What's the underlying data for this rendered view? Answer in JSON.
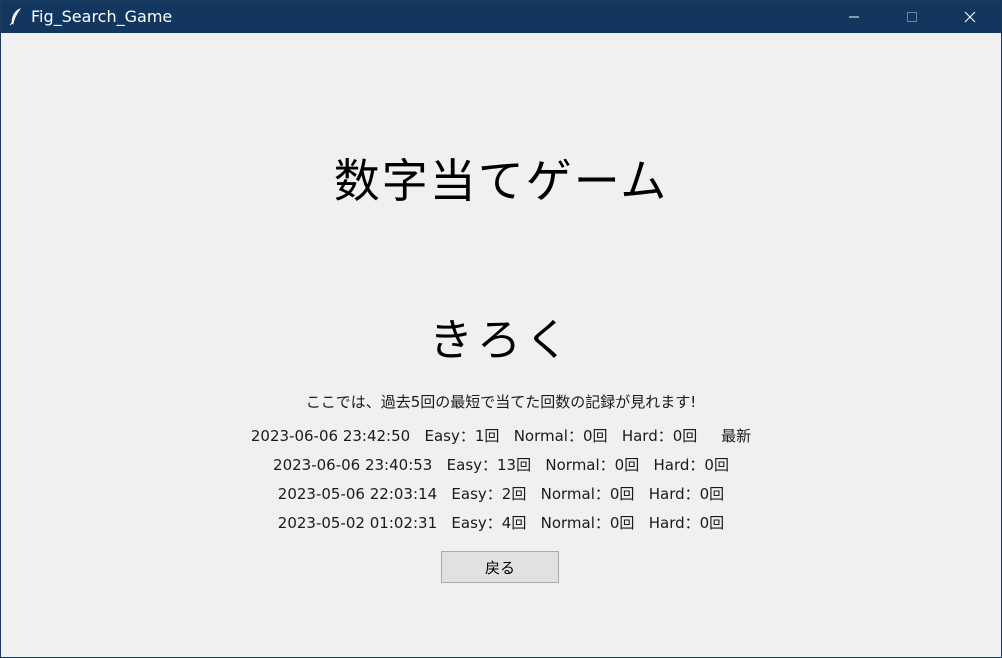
{
  "window": {
    "title": "Fig_Search_Game",
    "titlebar_color": "#12365e",
    "background_color": "#f0f0f0"
  },
  "main": {
    "title": "数字当てゲーム",
    "section_title": "きろく",
    "description": "ここでは、過去5回の最短で当てた回数の記録が見れます!"
  },
  "records": [
    {
      "text": "2023-06-06 23:42:50   Easy：1回   Normal：0回   Hard：0回     最新"
    },
    {
      "text": "2023-06-06 23:40:53   Easy：13回   Normal：0回   Hard：0回"
    },
    {
      "text": "2023-05-06 22:03:14   Easy：2回   Normal：0回   Hard：0回"
    },
    {
      "text": "2023-05-02 01:02:31   Easy：4回   Normal：0回   Hard：0回"
    }
  ],
  "buttons": {
    "back_label": "戻る"
  },
  "icons": {
    "app": "feather-icon",
    "minimize": "minimize-icon",
    "maximize": "maximize-icon",
    "close": "close-icon"
  }
}
